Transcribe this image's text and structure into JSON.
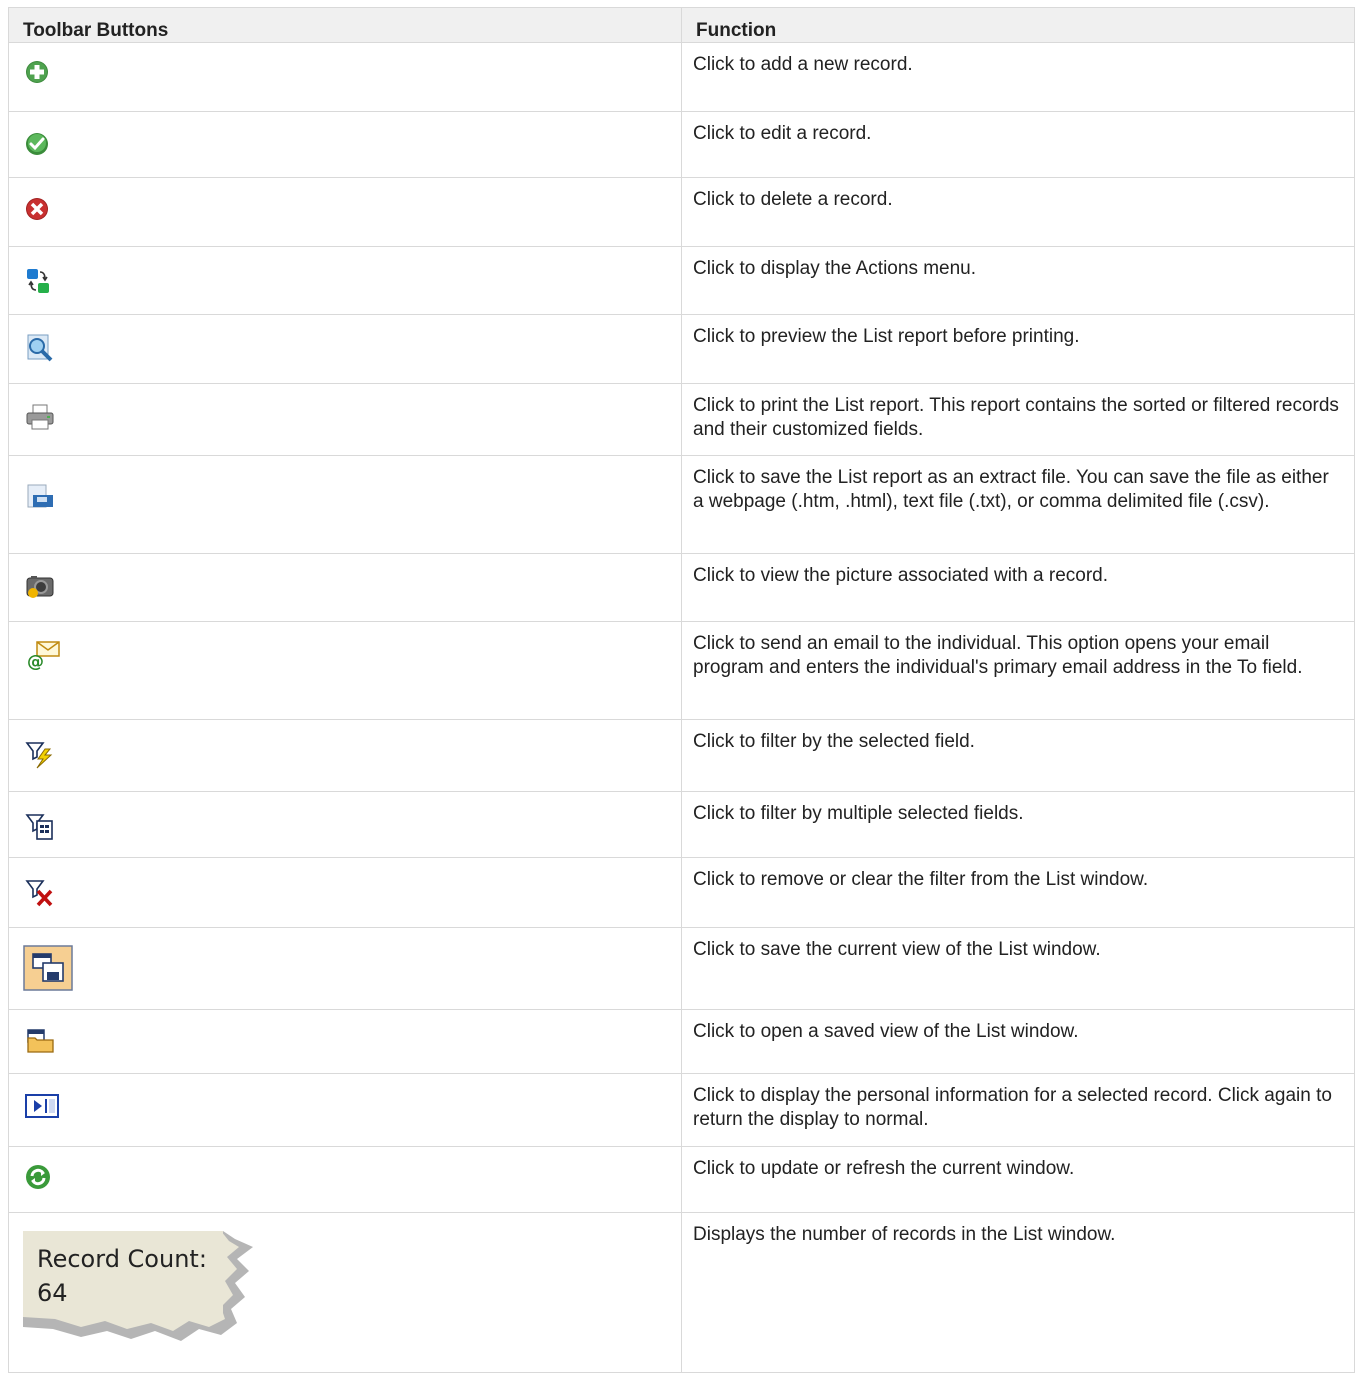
{
  "header": {
    "col1": "Toolbar Buttons",
    "col2": "Function"
  },
  "rows": [
    {
      "icon": "add-record-icon",
      "desc": "Click to add a new record."
    },
    {
      "icon": "edit-record-icon",
      "desc": "Click to edit a record."
    },
    {
      "icon": "delete-record-icon",
      "desc": "Click to delete a record."
    },
    {
      "icon": "actions-menu-icon",
      "desc": "Click to display the Actions menu."
    },
    {
      "icon": "print-preview-icon",
      "desc": "Click to preview the List report before printing."
    },
    {
      "icon": "print-icon",
      "desc": "Click to print the List report. This report contains the sorted or filtered records and their customized fields."
    },
    {
      "icon": "save-extract-icon",
      "desc": "Click to save the List report as an extract file. You can save the file as either a webpage (.htm, .html), text file (.txt), or comma delimited file (.csv)."
    },
    {
      "icon": "view-picture-icon",
      "desc": "Click to view the picture associated with a record."
    },
    {
      "icon": "send-email-icon",
      "desc": "Click to send an email to the individual. This option opens your email program and enters the individual's primary email address in the To field."
    },
    {
      "icon": "filter-selection-icon",
      "desc": "Click to filter by the selected field."
    },
    {
      "icon": "filter-multiple-icon",
      "desc": "Click to filter by multiple selected fields."
    },
    {
      "icon": "remove-filter-icon",
      "desc": "Click to remove or clear the filter from the List window."
    },
    {
      "icon": "save-view-icon",
      "desc": "Click to save the current view of the List window."
    },
    {
      "icon": "open-view-icon",
      "desc": "Click to open a saved view of the List window."
    },
    {
      "icon": "personal-info-icon",
      "desc": "Click to display the personal information for a selected record. Click again to return the display to normal."
    },
    {
      "icon": "refresh-icon",
      "desc": "Click to update or refresh the current window."
    },
    {
      "icon": "record-count-image",
      "desc": "Displays the number of records in the List window."
    }
  ],
  "record_count": {
    "label": "Record Count:",
    "value": "64"
  }
}
